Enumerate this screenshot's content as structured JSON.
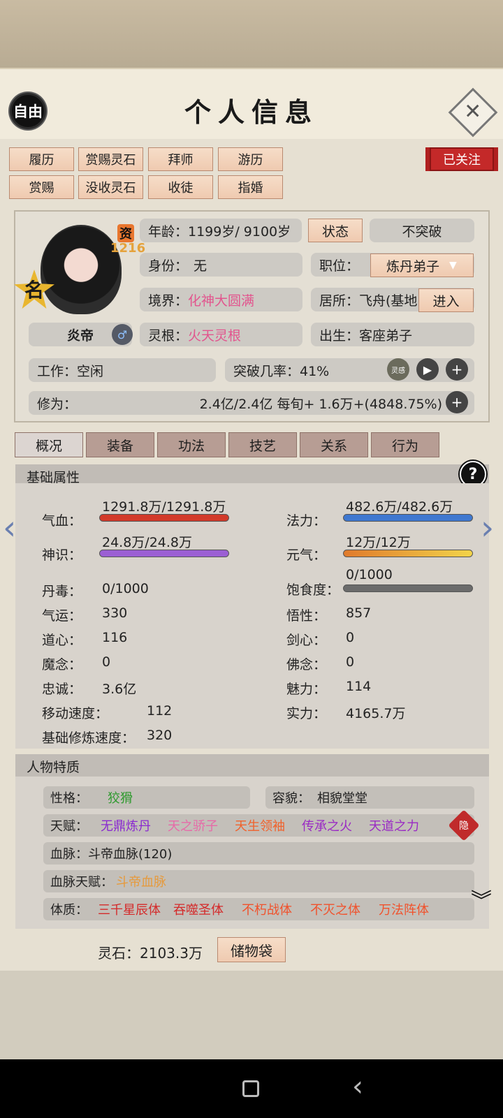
{
  "header": {
    "free_label": "自由",
    "title": "个人信息",
    "close_symbol": "✕"
  },
  "toolbar": {
    "row1": [
      "履历",
      "赏赐灵石",
      "拜师",
      "游历"
    ],
    "row2": [
      "赏赐",
      "没收灵石",
      "收徒",
      "指婚"
    ],
    "followed": "已关注"
  },
  "profile": {
    "avatar_label": "名",
    "zi": "资",
    "zi_value": "1216",
    "name": "炎帝",
    "gender_symbol": "♂",
    "age": "年龄：1199岁/ 9100岁",
    "status_button": "状态",
    "no_break": "不突破",
    "identity_label": "身份：",
    "identity_value": "无",
    "position_label": "职位：",
    "position_value": "炼丹弟子",
    "realm_label": "境界：",
    "realm_value": "化神大圆满",
    "residence": "居所：飞舟(基地",
    "enter_button": "进入",
    "root_label": "灵根：",
    "root_value": "火天灵根",
    "birth": "出生：客座弟子",
    "work": "工作：空闲",
    "breakthrough": "突破几率：41%",
    "cultivation_label": "修为：",
    "cultivation_value": "2.4亿/2.4亿  每旬+  1.6万+(4848.75%)",
    "chip_icon_label": "灵感"
  },
  "tabs": [
    "概况",
    "装备",
    "功法",
    "技艺",
    "关系",
    "行为"
  ],
  "basic": {
    "title": "基础属性",
    "help": "?",
    "qixue": {
      "label": "气血：",
      "value": "1291.8万/1291.8万",
      "fill": 1.0
    },
    "fali": {
      "label": "法力：",
      "value": "482.6万/482.6万",
      "fill": 1.0
    },
    "shenshi": {
      "label": "神识：",
      "value": "24.8万/24.8万",
      "fill": 1.0
    },
    "yuanqi": {
      "label": "元气：",
      "value": "12万/12万",
      "fill": 1.0
    },
    "baoshi": {
      "label": "饱食度：",
      "value": "0/1000",
      "fill": 0.0
    },
    "rows_left": [
      {
        "label": "丹毒：",
        "value": "0/1000"
      },
      {
        "label": "气运：",
        "value": "330"
      },
      {
        "label": "道心：",
        "value": "116"
      },
      {
        "label": "魔念：",
        "value": "0"
      },
      {
        "label": "忠诚：",
        "value": "3.6亿"
      },
      {
        "label": "移动速度：",
        "value": "112"
      },
      {
        "label": "基础修炼速度：",
        "value": "320"
      }
    ],
    "rows_right": [
      {
        "label": "悟性：",
        "value": "857"
      },
      {
        "label": "剑心：",
        "value": "0"
      },
      {
        "label": "佛念：",
        "value": "0"
      },
      {
        "label": "魅力：",
        "value": "114"
      },
      {
        "label": "实力：",
        "value": "4165.7万"
      }
    ],
    "colors": {
      "qixue": "#d23a2a",
      "fali": "#3f78d0",
      "shenshi": "#9b5fd4",
      "yuanqi": "#e8952f",
      "baoshi": "#6b6b6b"
    }
  },
  "traits": {
    "title": "人物特质",
    "personality_label": "性格：",
    "personality_value": "狡猾",
    "looks_label": "容貌：",
    "looks_value": "相貌堂堂",
    "talent_label": "天赋：",
    "talents": [
      "无鼎炼丹",
      "天之骄子",
      "天生领袖",
      "传承之火",
      "天道之力"
    ],
    "hide_badge": "隐",
    "bloodline": "血脉：斗帝血脉(120)",
    "bloodline_talent_label": "血脉天赋：",
    "bloodline_talent_value": "斗帝血脉",
    "physique_label": "体质：",
    "physiques": [
      "三千星辰体",
      "吞噬圣体",
      "不朽战体",
      "不灭之体",
      "万法阵体"
    ]
  },
  "footer": {
    "spirit_stones": "灵石：2103.3万",
    "bag_button": "储物袋"
  }
}
